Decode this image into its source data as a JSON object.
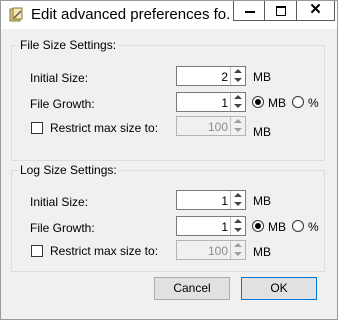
{
  "window": {
    "title": "Edit advanced preferences fo...",
    "controls": {
      "minimize_icon": "minimize-icon",
      "maximize_icon": "maximize-icon",
      "close_icon": "close-icon",
      "close_glyph": "✕"
    }
  },
  "file_size": {
    "group_label": "File Size Settings:",
    "initial_size": {
      "label": "Initial Size:",
      "value": "2",
      "unit": "MB"
    },
    "file_growth": {
      "label": "File Growth:",
      "value": "1",
      "unit_mb": "MB",
      "unit_percent": "%",
      "selected": "MB"
    },
    "restrict": {
      "label": "Restrict max size to:",
      "checked": false,
      "value": "100",
      "unit": "MB",
      "enabled": false
    }
  },
  "log_size": {
    "group_label": "Log Size Settings:",
    "initial_size": {
      "label": "Initial Size:",
      "value": "1",
      "unit": "MB"
    },
    "file_growth": {
      "label": "File Growth:",
      "value": "1",
      "unit_mb": "MB",
      "unit_percent": "%",
      "selected": "MB"
    },
    "restrict": {
      "label": "Restrict max size to:",
      "checked": false,
      "value": "100",
      "unit": "MB",
      "enabled": false
    }
  },
  "buttons": {
    "cancel": "Cancel",
    "ok": "OK"
  }
}
